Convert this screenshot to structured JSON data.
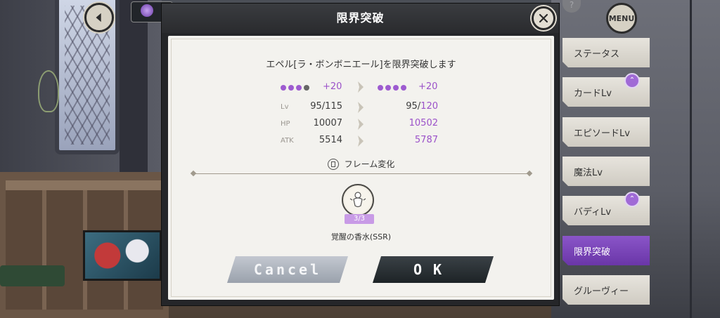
{
  "dialog": {
    "title": "限界突破",
    "subtitle": "エペル[ラ・ボンボニエール]を限界突破します",
    "stars": {
      "before_plus": "+20",
      "after_plus": "+20"
    },
    "stats": [
      {
        "label": "Lv",
        "before": "95/115",
        "after_prefix": "95/",
        "after_highlight": "120"
      },
      {
        "label": "HP",
        "before": "10007",
        "after_prefix": "",
        "after_highlight": "10502"
      },
      {
        "label": "ATK",
        "before": "5514",
        "after_prefix": "",
        "after_highlight": "5787"
      }
    ],
    "frame_change": "フレーム変化",
    "item": {
      "count": "3/3",
      "name": "覚醒の香水(SSR)"
    },
    "cancel_label": "Cancel",
    "ok_label": "OK"
  },
  "menu": {
    "menu_label": "MENU",
    "tabs": [
      "ステータス",
      "カードLv",
      "エピソードLv",
      "魔法Lv",
      "バディLv",
      "限界突破",
      "グルーヴィー"
    ],
    "active_tab": "限界突破"
  },
  "colors": {
    "accent": "#9b52c9",
    "active_tab": "#7a44b8",
    "panel": "#f3f2ee",
    "ok_button": "#262c30",
    "cancel_button": "#aeb4be"
  },
  "icons": {
    "back": "chevron-left-icon",
    "close": "close-icon",
    "item": "perfume-icon",
    "frame": "frame-icon",
    "arrow": "arrow-right-icon"
  }
}
